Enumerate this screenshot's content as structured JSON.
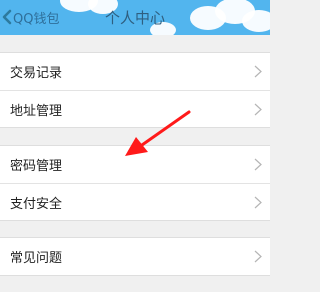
{
  "header": {
    "back_label": "QQ钱包",
    "title": "个人中心",
    "background_color": "#52b5ee"
  },
  "groups": [
    {
      "items": [
        {
          "label": "交易记录"
        },
        {
          "label": "地址管理"
        }
      ]
    },
    {
      "items": [
        {
          "label": "密码管理"
        },
        {
          "label": "支付安全"
        }
      ]
    },
    {
      "items": [
        {
          "label": "常见问题"
        }
      ]
    }
  ],
  "annotation": {
    "color": "#ff1a1a",
    "icon": "red-pointer-arrow"
  }
}
